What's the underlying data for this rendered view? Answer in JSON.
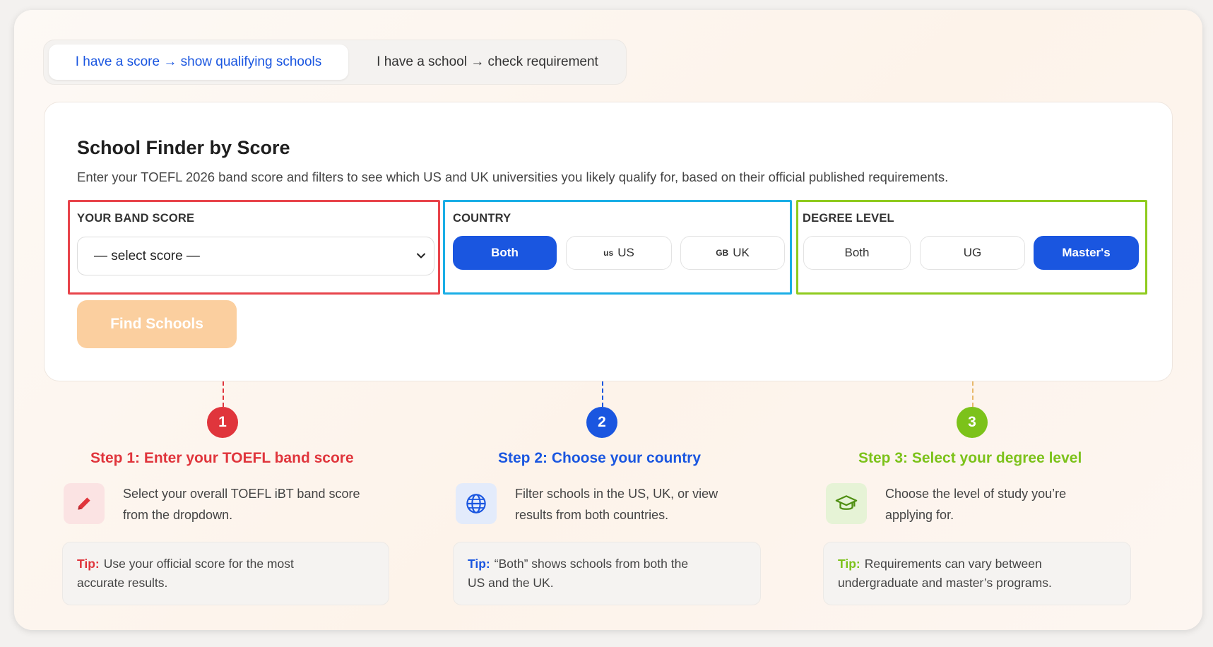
{
  "tabs": [
    {
      "label": "I have a score → show qualifying schools",
      "active": true
    },
    {
      "label": "I have a school → check requirement",
      "active": false
    }
  ],
  "finder": {
    "title": "School Finder by Score",
    "description": "Enter your TOEFL 2026 band score and filters to see which US and UK universities you likely qualify for, based on their official published requirements."
  },
  "band_score": {
    "label": "YOUR BAND SCORE",
    "select_value": "— select score —"
  },
  "country": {
    "label": "COUNTRY",
    "options": [
      {
        "label": "Both",
        "flag": "",
        "selected": true
      },
      {
        "label": "US",
        "flag": "us",
        "selected": false
      },
      {
        "label": "UK",
        "flag": "GB",
        "selected": false
      }
    ]
  },
  "degree": {
    "label": "DEGREE LEVEL",
    "options": [
      {
        "label": "Both",
        "selected": false
      },
      {
        "label": "UG",
        "selected": false
      },
      {
        "label": "Master's",
        "selected": true
      }
    ]
  },
  "find_button": "Find Schools",
  "steps": [
    {
      "number": "1",
      "title": "Step 1: Enter your TOEFL band score",
      "desc_line1": "Select your overall TOEFL iBT band score",
      "desc_line2": "from the dropdown.",
      "tip_label": "Tip:",
      "tip_line1": "Use your official score for the most",
      "tip_line2": "accurate results.",
      "icon": "pencil-icon",
      "color": "#e0353c"
    },
    {
      "number": "2",
      "title": "Step 2: Choose your country",
      "desc_line1": "Filter schools in the US, UK, or view",
      "desc_line2": "results from both countries.",
      "tip_label": "Tip:",
      "tip_line1": "“Both” shows schools from both the",
      "tip_line2": "US and the UK.",
      "icon": "globe-icon",
      "color": "#1a56e0"
    },
    {
      "number": "3",
      "title": "Step 3: Select your degree level",
      "desc_line1": "Choose the level of study you’re",
      "desc_line2": "applying for.",
      "tip_label": "Tip:",
      "tip_line1": "Requirements can vary between",
      "tip_line2": "undergraduate and master’s programs.",
      "icon": "graduation-cap-icon",
      "color": "#7cc21a"
    }
  ]
}
